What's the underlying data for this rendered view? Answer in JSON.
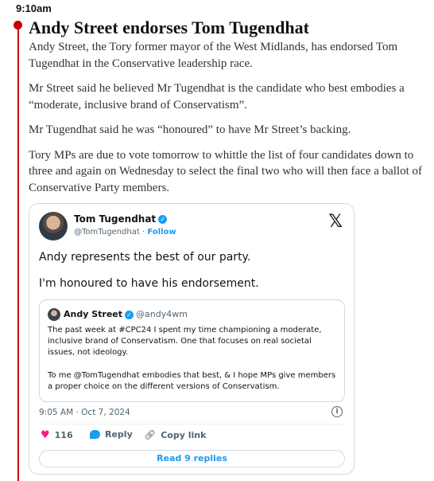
{
  "entry": {
    "time": "9:10am",
    "headline": "Andy Street endorses Tom Tugendhat",
    "paragraphs": [
      "Andy Street, the Tory former mayor of the West Midlands, has endorsed Tom Tugendhat in the Conservative leadership race.",
      "Mr Street said he believed Mr Tugendhat is the candidate who best embodies a “moderate, inclusive brand of Conservatism”.",
      "Mr Tugendhat said he was “honoured” to have Mr Street’s backing.",
      "Tory MPs are due to vote tomorrow to whittle the list of four candidates down to three and again on Wednesday to select the final two who will then face a ballot of Conservative Party members."
    ],
    "accent_color": "#c70000"
  },
  "tweet": {
    "author_name": "Tom Tugendhat",
    "author_handle": "@TomTugendhat",
    "separator": "·",
    "follow_label": "Follow",
    "platform_logo": "𝕏",
    "verified_icon": "verified-badge-icon",
    "text": [
      "Andy represents the best of our party.",
      "I'm honoured to have his endorsement."
    ],
    "quote": {
      "author_name": "Andy Street",
      "author_handle": "@andy4wm",
      "text": [
        "The past week at #CPC24 I spent my time championing a moderate, inclusive brand of Conservatism. One that focuses on real societal issues, not ideology.",
        "To me @TomTugendhat embodies that best, & I hope MPs give members a proper choice on the different versions of Conservatism."
      ]
    },
    "timestamp": "9:05 AM · Oct 7, 2024",
    "likes": "116",
    "reply_label": "Reply",
    "copy_link_label": "Copy link",
    "read_replies_label": "Read 9 replies",
    "colors": {
      "link": "#1d9bf0",
      "like": "#f91880",
      "muted": "#536471",
      "border": "#cfd9de"
    }
  }
}
